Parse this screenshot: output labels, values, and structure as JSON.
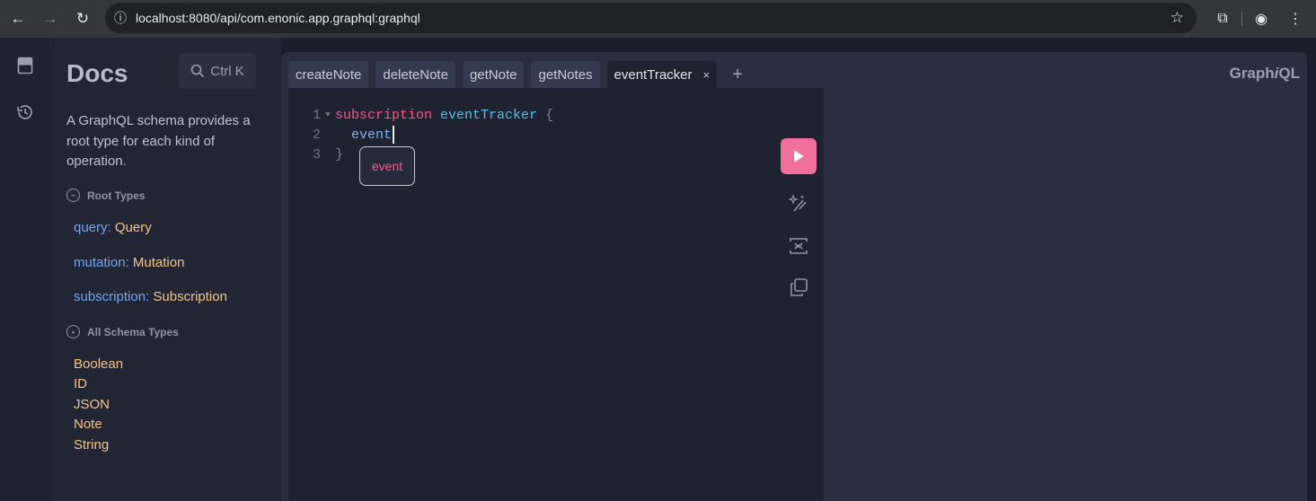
{
  "browser": {
    "url": "localhost:8080/api/com.enonic.app.graphql:graphql"
  },
  "icons": {
    "back": "arrow-left-icon",
    "forward": "arrow-right-icon",
    "reload": "reload-icon",
    "info": "info-icon",
    "bookmark": "star-icon",
    "extensions": "puzzle-icon",
    "profile": "profile-icon",
    "menu": "kebab-menu-icon",
    "docs": "book-icon",
    "history": "history-icon",
    "search": "search-icon",
    "run": "play-icon",
    "prettify": "magic-wand-icon",
    "merge": "merge-fragments-icon",
    "copy": "copy-icon"
  },
  "colors": {
    "accent": "#f0709b",
    "field": "#6ea8f0",
    "type": "#f2c689",
    "keyword": "#f25c8c",
    "name": "#4fc3e8"
  },
  "docs": {
    "title": "Docs",
    "search_label": "Ctrl K",
    "description": "A GraphQL schema provides a root type for each kind of operation.",
    "root_types_heading": "Root Types",
    "root_types": [
      {
        "field": "query",
        "sep": ": ",
        "type": "Query"
      },
      {
        "field": "mutation",
        "sep": ": ",
        "type": "Mutation"
      },
      {
        "field": "subscription",
        "sep": ": ",
        "type": "Subscription"
      }
    ],
    "all_types_heading": "All Schema Types",
    "all_types": [
      "Boolean",
      "ID",
      "JSON",
      "Note",
      "String"
    ]
  },
  "tabs": [
    {
      "label": "createNote",
      "active": false
    },
    {
      "label": "deleteNote",
      "active": false
    },
    {
      "label": "getNote",
      "active": false
    },
    {
      "label": "getNotes",
      "active": false
    },
    {
      "label": "eventTracker",
      "active": true
    }
  ],
  "tab_close_label": "×",
  "add_tab_label": "+",
  "logo": {
    "part1": "Graph",
    "part2": "i",
    "part3": "QL"
  },
  "editor": {
    "lines": [
      {
        "num": "1",
        "keyword": "subscription",
        "space": " ",
        "name": "eventTracker",
        "space2": " ",
        "punct": "{"
      },
      {
        "num": "2",
        "indent": "  ",
        "text": "event"
      },
      {
        "num": "3",
        "punct": "}"
      }
    ],
    "autocomplete": "event"
  }
}
